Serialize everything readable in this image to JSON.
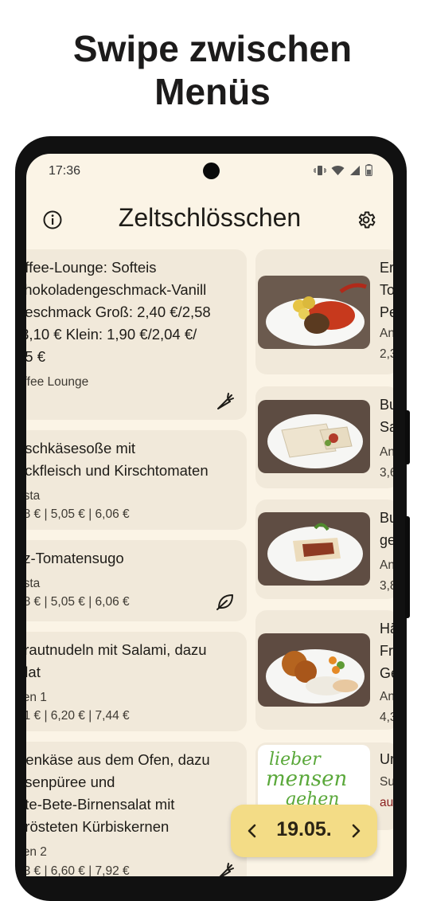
{
  "headline": {
    "line1": "Swipe zwischen",
    "line2": "Menüs"
  },
  "status_bar": {
    "time": "17:36"
  },
  "app_bar": {
    "title": "Zeltschlösschen"
  },
  "left_menu": [
    {
      "title": "affee-Lounge: Softeis\nchokoladengeschmack-Vanill\ngeschmack Groß: 2,40 €/2,58\n/3,10 € Klein: 1,90 €/2,04 €/\n45 €",
      "category": "affee Lounge",
      "price": "",
      "tag_icon": "vegetarian-carrot-icon"
    },
    {
      "title": "rischkäsesoße mit\nackfleisch und Kirschtomaten",
      "category": "asta",
      "price": "78 € | 5,05 € | 6,06 €",
      "tag_icon": ""
    },
    {
      "title": "ilz-Tomatensugo",
      "category": "asta",
      "price": "78 € | 5,05 € | 6,06 €",
      "tag_icon": "vegan-leaf-icon"
    },
    {
      "title": "krautnudeln mit Salami, dazu\nalat",
      "category": "sen 1",
      "price": "41 € | 6,20 € | 7,44 €",
      "tag_icon": ""
    },
    {
      "title": "rtenkäse aus dem Ofen, dazu\nbsenpüree und\note-Bete-Birnensalat mit\nerösteten Kürbiskernen",
      "category": "sen 2",
      "price": "53 € | 6,60 € | 7,92 €",
      "tag_icon": "vegetarian-carrot-icon"
    }
  ],
  "right_menu": [
    {
      "title": "Er\nTo\nPe",
      "category": "An",
      "price": "2,3"
    },
    {
      "title": "Bu\nSa",
      "category": "An",
      "price": "3,6"
    },
    {
      "title": "Bu\nge",
      "category": "An",
      "price": "3,8"
    },
    {
      "title": "Hä\nFr\nGe",
      "category": "An",
      "price": "4,3"
    },
    {
      "title": "Ur",
      "category": "Su",
      "price": "au"
    }
  ],
  "logo_text": {
    "line1": "lieber",
    "line2": "mensen",
    "line3": "gehen"
  },
  "date_switcher": {
    "date": "19.05."
  },
  "colors": {
    "background": "#fbf4e6",
    "card": "#f1e9da",
    "date_pill": "#f3dc86"
  }
}
